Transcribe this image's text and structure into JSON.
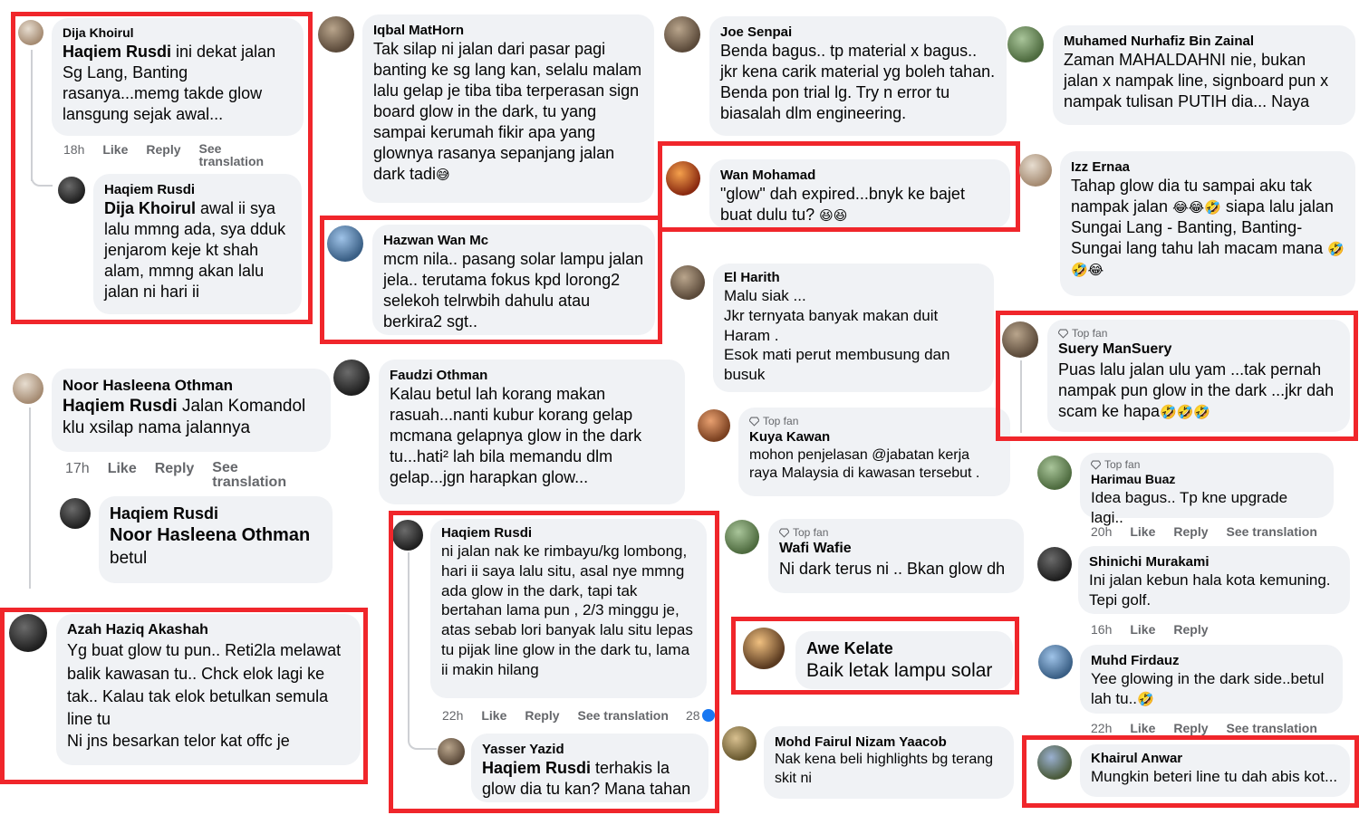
{
  "colors": {
    "highlight": "#f0262b",
    "bubble": "#f0f2f5",
    "meta": "#65676b"
  },
  "labels": {
    "like": "Like",
    "reply": "Reply",
    "see_translation": "See translation",
    "top_fan": "Top fan"
  },
  "comments": {
    "c1": {
      "author": "Dija Khoirul",
      "tag": "Haqiem Rusdi",
      "text": " ini dekat jalan Sg Lang, Banting rasanya...memg takde glow lansgung sejak awal...",
      "time": "18h"
    },
    "c1r": {
      "author": "Haqiem Rusdi",
      "tag": "Dija Khoirul",
      "text": " awal ii sya lalu mmng ada, sya dduk jenjarom keje kt shah alam, mmng akan lalu jalan ni hari ii"
    },
    "c2": {
      "author": "Iqbal MatHorn",
      "text": "Tak silap ni jalan dari pasar pagi banting ke sg lang kan, selalu malam lalu gelap je tiba tiba terperasan sign board glow in the dark, tu yang sampai kerumah fikir apa yang glownya rasanya sepanjang jalan dark tadi",
      "emoji": "😅"
    },
    "c3": {
      "author": "Hazwan Wan Mc",
      "text": "mcm nila.. pasang solar lampu jalan jela.. terutama fokus kpd lorong2 selekoh telrwbih dahulu atau berkira2 sgt.."
    },
    "c4": {
      "author": "Joe Senpai",
      "text": "Benda bagus.. tp material x bagus.. jkr kena carik material yg boleh tahan. Benda pon trial lg. Try n error tu biasalah dlm engineering."
    },
    "c5": {
      "author": "Wan Mohamad",
      "text": "\"glow\" dah expired...bnyk ke bajet buat dulu tu?",
      "emoji": "😆😆"
    },
    "c6": {
      "author": "El Harith",
      "text1": "Malu siak ...",
      "text2": "Jkr ternyata banyak makan duit Haram .",
      "text3": "Esok mati perut membusung dan busuk"
    },
    "c7": {
      "author": "Muhamed Nurhafiz Bin Zainal",
      "text": "Zaman MAHALDAHNI nie, bukan jalan x nampak line, signboard pun x nampak tulisan PUTIH dia... Naya"
    },
    "c8": {
      "author": "Izz Ernaa",
      "text1": "Tahap glow dia tu sampai aku tak nampak jalan ",
      "emoji1": "😂😂🤣",
      "text2": " siapa lalu jalan Sungai Lang - Banting, Banting-Sungai lang tahu lah macam mana ",
      "emoji2": "🤣🤣😂"
    },
    "c9": {
      "author": "Suery ManSuery",
      "text": "Puas lalu jalan ulu yam ...tak pernah nampak pun glow in the dark ...jkr dah scam ke hapa",
      "emoji": "🤣🤣🤣"
    },
    "c10": {
      "author": "Noor Hasleena Othman",
      "tag": "Haqiem Rusdi",
      "text": " Jalan Komandol klu xsilap nama jalannya",
      "time": "17h"
    },
    "c10r": {
      "author": "Haqiem Rusdi",
      "tag": "Noor Hasleena Othman",
      "text": "betul"
    },
    "c11": {
      "author": "Faudzi Othman",
      "text": "Kalau betul lah korang makan rasuah...nanti kubur korang gelap mcmana gelapnya glow in the dark tu...hati² lah bila memandu dlm gelap...jgn harapkan glow..."
    },
    "c12": {
      "author": "Kuya Kawan",
      "text": "mohon penjelasan @jabatan kerja raya Malaysia di kawasan tersebut ."
    },
    "c13": {
      "author": "Harimau Buaz",
      "text": "Idea bagus.. Tp kne upgrade lagi..",
      "time": "20h"
    },
    "c14": {
      "author": "Haqiem Rusdi",
      "text": "ni jalan nak ke rimbayu/kg lombong, hari ii saya lalu situ, asal nye mmng ada glow in the dark, tapi tak bertahan lama pun , 2/3 minggu je, atas sebab lori banyak lalu situ lepas tu pijak line glow in the dark tu, lama ii makin hilang",
      "time": "22h",
      "reactions": "28"
    },
    "c14r": {
      "author": "Yasser Yazid",
      "tag": "Haqiem Rusdi",
      "text": " terhakis la glow dia tu kan? Mana tahan"
    },
    "c15": {
      "author": "Wafi Wafie",
      "text": "Ni dark terus ni .. Bkan glow dh"
    },
    "c16": {
      "author": "Shinichi Murakami",
      "text": "Ini jalan kebun hala kota kemuning. Tepi golf.",
      "time": "16h"
    },
    "c17": {
      "author": "Azah Haziq Akashah",
      "text1": "Yg buat glow tu pun.. Reti2la melawat balik kawasan tu.. Chck elok lagi ke tak.. Kalau tak elok betulkan semula line tu",
      "text2": "Ni jns besarkan telor kat offc je"
    },
    "c18": {
      "author": "Awe Kelate",
      "text": "Baik letak lampu solar"
    },
    "c19": {
      "author": "Muhd Firdauz",
      "text": "Yee glowing in the dark side..betul lah tu..",
      "emoji": "🤣",
      "time": "22h"
    },
    "c20": {
      "author": "Mohd Fairul Nizam Yaacob",
      "text": "Nak kena beli highlights bg terang skit ni"
    },
    "c21": {
      "author": "Khairul Anwar",
      "text": "Mungkin beteri line tu dah abis kot..."
    }
  }
}
